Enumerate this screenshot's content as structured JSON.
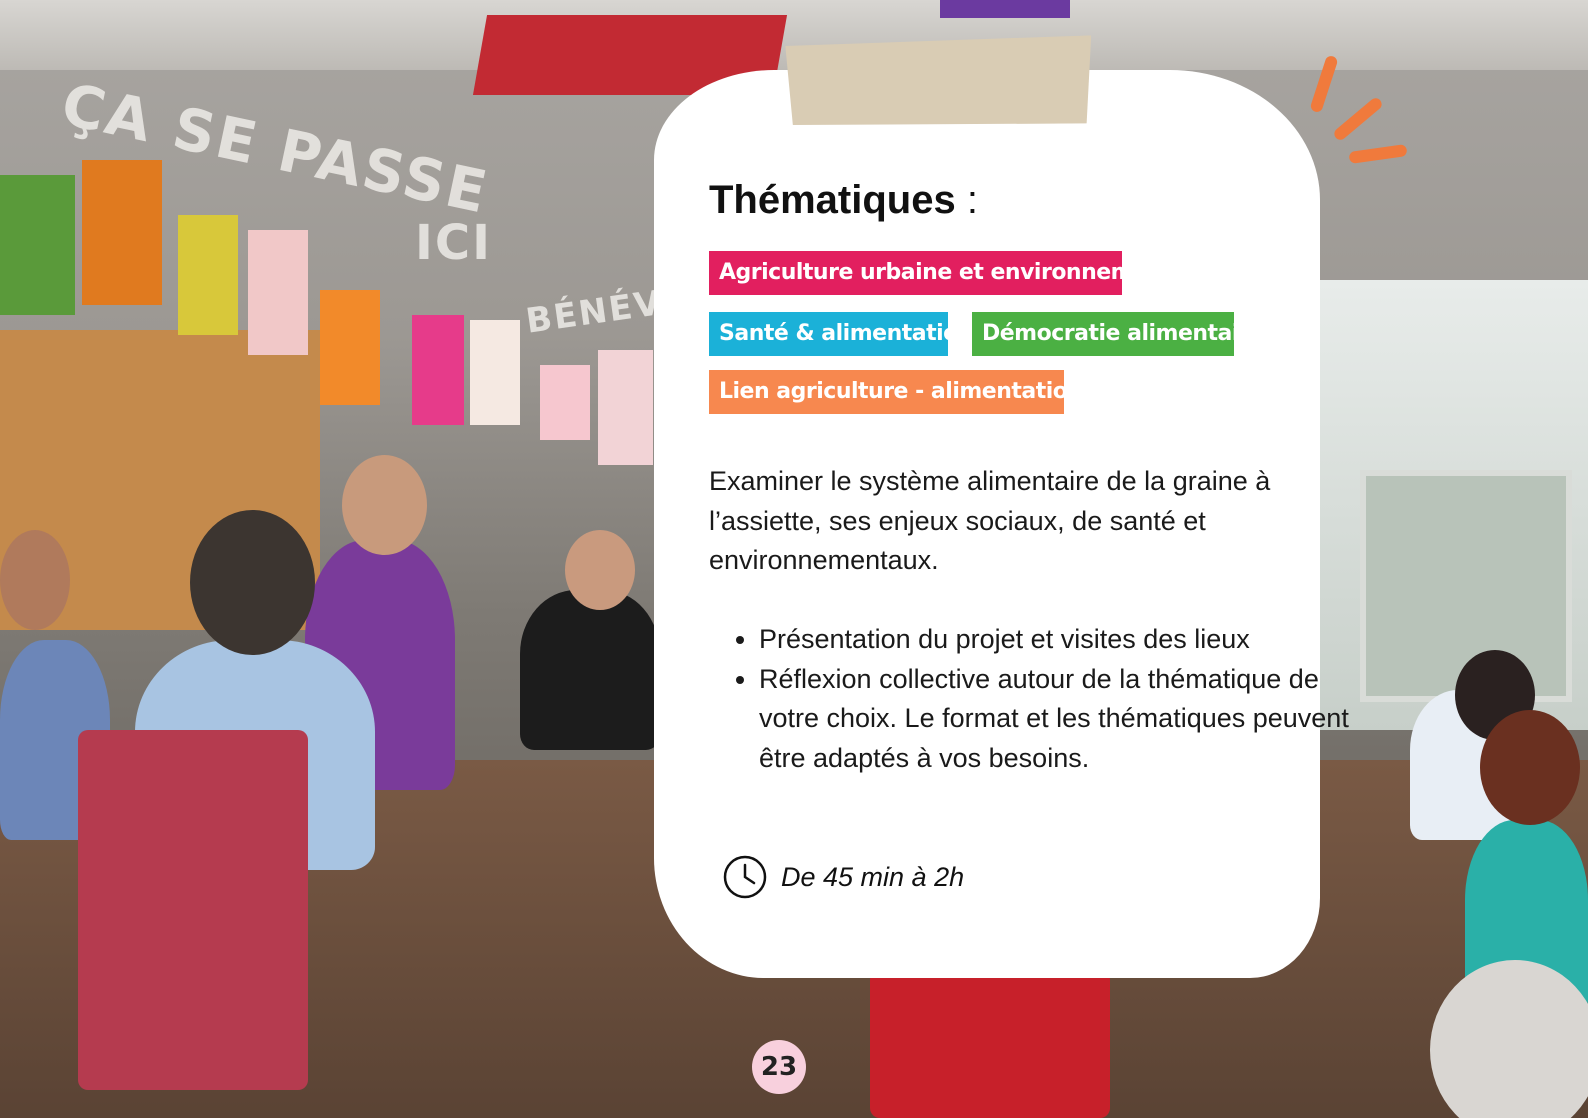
{
  "card": {
    "title": "Thématiques",
    "title_colon": " :",
    "tags": [
      {
        "label": "Agriculture urbaine et environnement",
        "color": "#e21f5f"
      },
      {
        "label": "Santé & alimentation",
        "color": "#1bb1d8"
      },
      {
        "label": "Démocratie alimentaire",
        "color": "#4bb043"
      },
      {
        "label": "Lien agriculture - alimentation",
        "color": "#f7884f"
      }
    ],
    "intro": "Examiner le système alimentaire de la graine à l’assiette, ses enjeux sociaux, de santé et environnementaux.",
    "bullets": [
      "Présentation du projet et visites des lieux",
      "Réflexion collective autour de la thématique de votre choix. Le format et les thématiques peuvent être adaptés à vos besoins."
    ],
    "duration": "De 45 min à 2h",
    "duration_icon": "clock-icon"
  },
  "photo": {
    "wall_text_1": "ÇA SE PASSE",
    "wall_text_2": "ICI",
    "wall_text_3": "BÉNÉVOLAT"
  },
  "page_number": "23",
  "colors": {
    "accent_orange": "#f07a3c",
    "tape": "#d9ccb4",
    "page_badge": "#f8d0dd"
  }
}
